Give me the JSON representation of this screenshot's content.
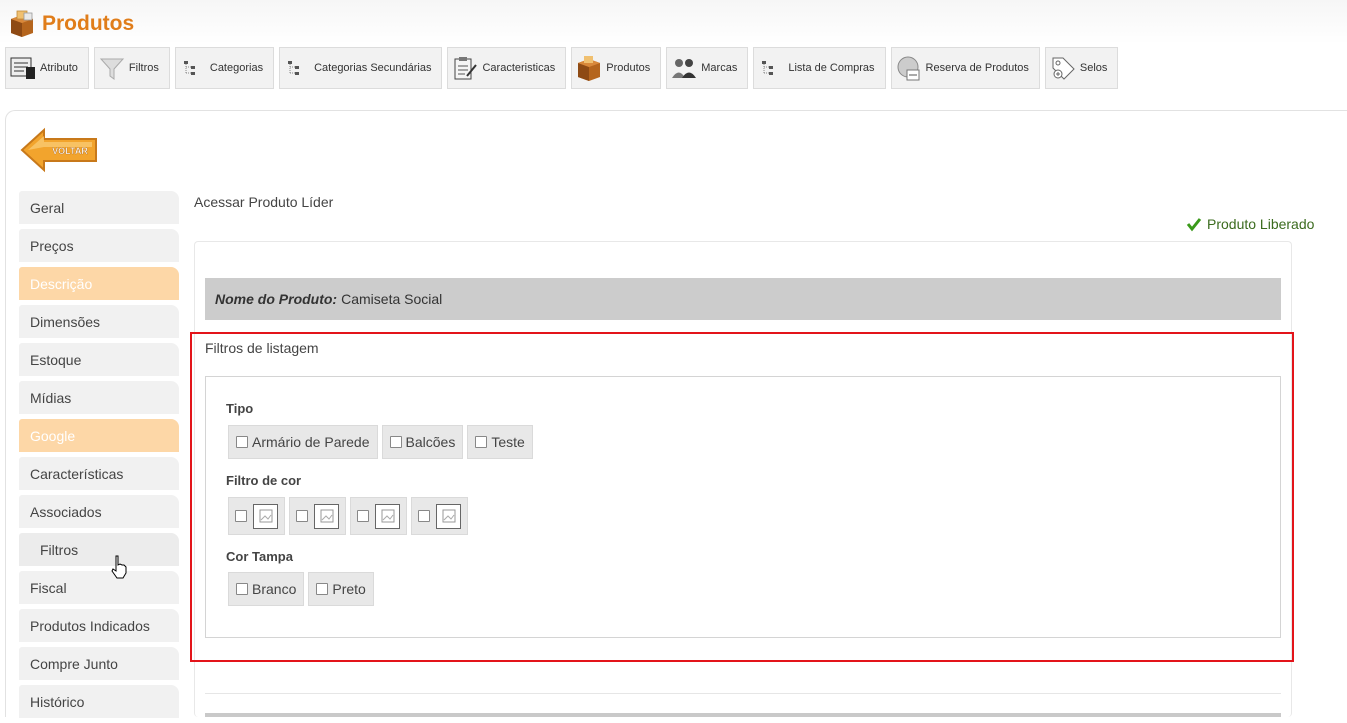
{
  "app": {
    "title": "Produtos"
  },
  "toolbar": [
    {
      "label": "Atributo",
      "icon": "attribute-icon"
    },
    {
      "label": "Filtros",
      "icon": "funnel-icon"
    },
    {
      "label": "Categorias",
      "icon": "tree-icon"
    },
    {
      "label": "Categorias Secundárias",
      "icon": "tree-icon"
    },
    {
      "label": "Caracteristicas",
      "icon": "clipboard-icon"
    },
    {
      "label": "Produtos",
      "icon": "box-icon"
    },
    {
      "label": "Marcas",
      "icon": "people-icon"
    },
    {
      "label": "Lista de Compras",
      "icon": "tree-icon"
    },
    {
      "label": "Reserva de Produtos",
      "icon": "calendar-icon"
    },
    {
      "label": "Selos",
      "icon": "tag-icon"
    }
  ],
  "back": {
    "label": "VOLTAR"
  },
  "sidebar": {
    "items": [
      {
        "label": "Geral"
      },
      {
        "label": "Preços"
      },
      {
        "label": "Descrição"
      },
      {
        "label": "Dimensões"
      },
      {
        "label": "Estoque"
      },
      {
        "label": "Mídias"
      },
      {
        "label": "Google"
      },
      {
        "label": "Características"
      },
      {
        "label": "Associados"
      },
      {
        "label": "Filtros"
      },
      {
        "label": "Fiscal"
      },
      {
        "label": "Produtos Indicados"
      },
      {
        "label": "Compre Junto"
      },
      {
        "label": "Histórico"
      }
    ]
  },
  "main": {
    "acessar_label": "Acessar Produto Líder",
    "status_label": "Produto Liberado",
    "product_name_label": "Nome do Produto:",
    "product_name_value": "Camiseta Social",
    "section_title": "Filtros de listagem",
    "groups": {
      "tipo": {
        "label": "Tipo",
        "options": [
          "Armário de Parede",
          "Balcões",
          "Teste"
        ]
      },
      "cor": {
        "label": "Filtro de cor"
      },
      "tampa": {
        "label": "Cor Tampa",
        "options": [
          "Branco",
          "Preto"
        ]
      }
    }
  },
  "colors": {
    "brand": "#e07d1a",
    "highlight_tab": "#fdd7a7",
    "annotation_red": "#e3141a",
    "status_green": "#3b6b1e"
  }
}
